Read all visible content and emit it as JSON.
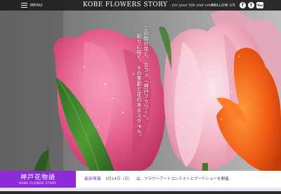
{
  "header": {
    "menu_label": "MENU",
    "brand_name": "KOBE FLOWERS STORY",
    "brand_tagline": "- for your life and smile -",
    "follow_label": "FOLLOW US",
    "sns": [
      {
        "name": "facebook-icon",
        "glyph": "f"
      },
      {
        "name": "twitter-icon",
        "glyph": "t"
      },
      {
        "name": "youtube-icon",
        "glyph": "You"
      }
    ]
  },
  "catch_copy": {
    "line1": "この街の花と、カフェ「神戸フラワー」。",
    "line2": "彩りに咲く、その季節と花のあるスタイル。"
  },
  "footer": {
    "logo_jp": "神戸花物語",
    "logo_en": "KOBE FLOWER STORY",
    "news_label": "最新情報",
    "news_date": "3月14日（日）",
    "news_text": "は、フラワーアートコンテストとブーケショーを開催。"
  },
  "colors": {
    "accent": "#8e2bd8",
    "topbar": "#1e1e1e"
  }
}
